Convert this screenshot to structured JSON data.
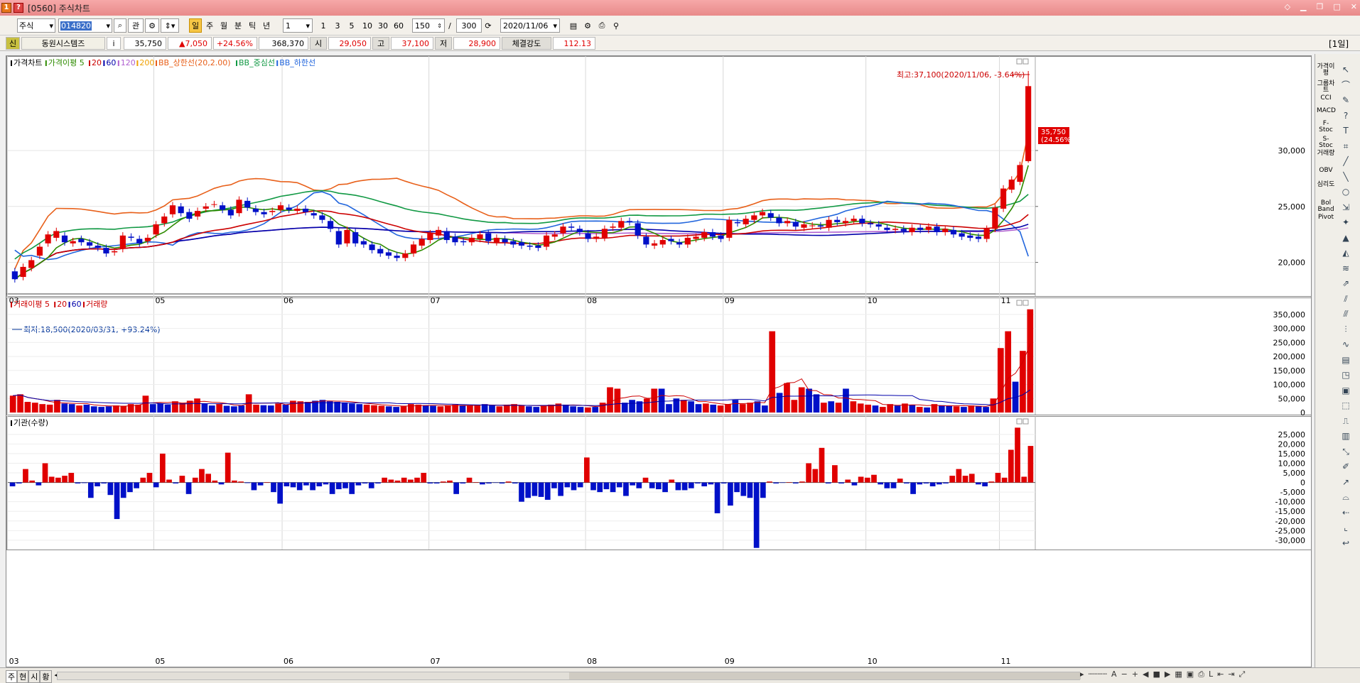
{
  "window": {
    "title": "[0560] 주식차트",
    "btn1": "1",
    "btn2": "?"
  },
  "toolbar": {
    "market": "주식",
    "code": "014820",
    "find": "관",
    "periods": [
      "일",
      "주",
      "월",
      "분",
      "틱",
      "년"
    ],
    "tick_value": "1",
    "minute_opts": [
      "1",
      "3",
      "5",
      "10",
      "30",
      "60"
    ],
    "count": "150",
    "total": "300",
    "date": "2020/11/06"
  },
  "info": {
    "flag": "신",
    "name": "동원시스템즈",
    "info_btn": "i",
    "price": "35,750",
    "change": "▲7,050",
    "rate": "+24.56%",
    "volume": "368,370",
    "open_label": "시",
    "open": "29,050",
    "high_label": "고",
    "high": "37,100",
    "low_label": "저",
    "low": "28,900",
    "strength_label": "체결강도",
    "strength": "112.13",
    "period_badge": "[1일]"
  },
  "legend": {
    "price": [
      {
        "t": "가격차트",
        "c": "#000000"
      },
      {
        "t": "가격이평 5",
        "c": "#2e8b00"
      },
      {
        "t": "20",
        "c": "#cc0000"
      },
      {
        "t": "60",
        "c": "#0000aa"
      },
      {
        "t": "120",
        "c": "#b060d0"
      },
      {
        "t": "200",
        "c": "#f0a000"
      },
      {
        "t": "BB_상한선(20,2.00)",
        "c": "#e8601a"
      },
      {
        "t": "BB_중심선",
        "c": "#119944"
      },
      {
        "t": "BB_하한선",
        "c": "#2266dd"
      }
    ],
    "volume": [
      {
        "t": "거래이평 5",
        "c": "#cc0000"
      },
      {
        "t": "20",
        "c": "#cc0000"
      },
      {
        "t": "60",
        "c": "#0000aa"
      },
      {
        "t": "거래량",
        "c": "#cc0000"
      }
    ],
    "inst": [
      {
        "t": "기관(수량)",
        "c": "#000000"
      }
    ]
  },
  "annotations": {
    "high": "최고:37,100(2020/11/06, -3.64%)",
    "low": "최저:18,500(2020/03/31, +93.24%)",
    "last_price": "35,750",
    "last_rate": "(24.56%)"
  },
  "x_labels": [
    "03",
    "05",
    "06",
    "07",
    "08",
    "09",
    "10",
    "11"
  ],
  "price_axis": [
    "30,000",
    "25,000",
    "20,000"
  ],
  "volume_axis": [
    "350,000",
    "300,000",
    "250,000",
    "200,000",
    "150,000",
    "100,000",
    "50,000",
    "0"
  ],
  "inst_axis": [
    "25,000",
    "20,000",
    "15,000",
    "10,000",
    "5,000",
    "0",
    "-5,000",
    "-10,000",
    "-15,000",
    "-20,000",
    "-25,000",
    "-30,000"
  ],
  "right_tools": [
    "가격이평",
    "그룹차트",
    "CCI",
    "MACD",
    "F-Stoc",
    "S-Stoc",
    "거래량",
    "OBV",
    "심리도",
    "Bol Band",
    "Pivot"
  ],
  "bottom": {
    "tabs": [
      "주",
      "현",
      "시",
      "황"
    ]
  },
  "chart_data": [
    {
      "type": "candlestick",
      "title": "가격차트",
      "ylim": [
        17500,
        37800
      ],
      "close": [
        18500,
        19600,
        20200,
        21400,
        22500,
        22800,
        21800,
        21900,
        21800,
        21500,
        21300,
        20800,
        21000,
        22400,
        22200,
        21700,
        22200,
        23400,
        24100,
        25100,
        24400,
        23900,
        24600,
        25000,
        25200,
        24700,
        24200,
        25600,
        24900,
        24500,
        24300,
        24600,
        25100,
        24700,
        24800,
        24500,
        24200,
        23800,
        23000,
        21600,
        22900,
        21700,
        21600,
        21100,
        20800,
        20600,
        20400,
        20800,
        21600,
        22100,
        22600,
        22900,
        22000,
        21800,
        21800,
        22200,
        22500,
        21900,
        22200,
        21800,
        21600,
        21500,
        21400,
        21300,
        22400,
        22500,
        23200,
        23100,
        22700,
        22100,
        22300,
        23000,
        23200,
        23700,
        23600,
        22400,
        21600,
        21700,
        22000,
        21900,
        21600,
        22200,
        22300,
        22700,
        22300,
        22100,
        23800,
        23500,
        23900,
        24200,
        24500,
        24000,
        23500,
        23700,
        23200,
        23400,
        23300,
        23200,
        23800,
        23600,
        23700,
        23900,
        23500,
        23400,
        23200,
        22900,
        23000,
        22800,
        23100,
        22900,
        23200,
        22700,
        23000,
        22500,
        22300,
        22200,
        22100,
        23000,
        24900,
        26600,
        27400,
        28700,
        35750
      ],
      "open": [
        19200,
        18700,
        19500,
        20600,
        21700,
        22200,
        22400,
        21700,
        22100,
        21800,
        21500,
        21300,
        20900,
        21200,
        22300,
        22100,
        21900,
        22500,
        23500,
        24300,
        25000,
        24500,
        24100,
        24800,
        25200,
        25100,
        24700,
        24400,
        25500,
        24800,
        24500,
        24500,
        24700,
        24900,
        24600,
        24800,
        24400,
        24200,
        23700,
        22800,
        21700,
        22700,
        21900,
        21600,
        21200,
        20900,
        20600,
        20400,
        20800,
        21500,
        22000,
        22400,
        22800,
        22300,
        21900,
        21800,
        22100,
        22600,
        21800,
        22100,
        21900,
        21800,
        21500,
        21500,
        21400,
        22300,
        22600,
        23200,
        23000,
        22600,
        22100,
        22200,
        23100,
        23100,
        23700,
        23500,
        22300,
        21500,
        21600,
        22100,
        21800,
        21600,
        22100,
        22200,
        22700,
        22400,
        22200,
        23600,
        23400,
        23800,
        24200,
        24400,
        24000,
        23500,
        23600,
        23100,
        23300,
        23300,
        23100,
        23800,
        23500,
        23700,
        23900,
        23500,
        23400,
        23100,
        22900,
        23000,
        22700,
        23100,
        22900,
        23200,
        22700,
        22900,
        22600,
        22400,
        22300,
        22100,
        23000,
        24800,
        26500,
        27200,
        29050
      ]
    },
    {
      "type": "bar",
      "title": "거래량",
      "ylim": [
        0,
        370000
      ],
      "values": [
        60000,
        65000,
        38000,
        35000,
        30000,
        28000,
        45000,
        32000,
        30000,
        25000,
        28000,
        22000,
        20000,
        22000,
        25000,
        24000,
        30000,
        28000,
        60000,
        30000,
        32000,
        28000,
        40000,
        35000,
        42000,
        50000,
        32000,
        25000,
        30000,
        24000,
        22000,
        25000,
        65000,
        28000,
        26000,
        25000,
        32000,
        28000,
        42000,
        40000,
        38000,
        42000,
        45000,
        40000,
        38000,
        36000,
        32000,
        30000,
        28000,
        26000,
        24000,
        22000,
        20000,
        22000,
        30000,
        28000,
        26000,
        24000,
        22000,
        25000,
        28000,
        26000,
        24000,
        28000,
        30000,
        25000,
        22000,
        28000,
        30000,
        24000,
        22000,
        20000,
        24000,
        28000,
        32000,
        28000,
        22000,
        20000,
        18000,
        20000,
        35000,
        90000,
        85000,
        35000,
        45000,
        40000,
        50000,
        85000,
        85000,
        30000,
        50000,
        45000,
        40000,
        30000,
        32000,
        28000,
        25000,
        30000,
        45000,
        30000,
        35000,
        40000,
        25000,
        290000,
        70000,
        105000,
        45000,
        90000,
        85000,
        65000,
        35000,
        40000,
        35000,
        85000,
        40000,
        32000,
        28000,
        25000,
        20000,
        30000,
        25000,
        32000,
        28000,
        20000,
        18000,
        30000,
        26000,
        25000,
        22000,
        20000,
        25000,
        22000,
        20000,
        50000,
        230000,
        290000,
        110000,
        220000,
        368370
      ],
      "colors": [
        "r",
        "r",
        "r",
        "r",
        "r",
        "r",
        "r",
        "b",
        "b",
        "r",
        "b",
        "b",
        "b",
        "b",
        "r",
        "r",
        "r",
        "r",
        "r",
        "b",
        "b",
        "b",
        "r",
        "r",
        "r",
        "r",
        "b",
        "b",
        "r",
        "b",
        "b",
        "b",
        "r",
        "r",
        "b",
        "b",
        "r",
        "b",
        "r",
        "r",
        "b",
        "b",
        "b",
        "b",
        "b",
        "b",
        "b",
        "b",
        "r",
        "r",
        "r",
        "b",
        "b",
        "r",
        "r",
        "r",
        "b",
        "b",
        "r",
        "r",
        "r",
        "b",
        "r",
        "r",
        "b",
        "b",
        "r",
        "r",
        "r",
        "r",
        "b",
        "b",
        "r",
        "r",
        "r",
        "b",
        "b",
        "b",
        "r",
        "b",
        "r",
        "r",
        "r",
        "b",
        "b",
        "b",
        "r",
        "r",
        "b",
        "b",
        "b",
        "r",
        "b",
        "b",
        "r",
        "b",
        "r",
        "r",
        "b",
        "r",
        "r",
        "b",
        "b",
        "r",
        "b",
        "r",
        "r",
        "r",
        "b",
        "b",
        "r",
        "b",
        "r",
        "b",
        "r",
        "r",
        "r",
        "b",
        "r",
        "r",
        "b",
        "r",
        "b",
        "r",
        "b",
        "r",
        "b",
        "b",
        "r",
        "b",
        "r",
        "b",
        "b",
        "r",
        "r",
        "r",
        "b",
        "r",
        "r"
      ]
    },
    {
      "type": "bar",
      "title": "기관(수량)",
      "ylim": [
        -33000,
        29000
      ],
      "values": [
        -2000,
        -500,
        7000,
        1000,
        -1500,
        10000,
        3000,
        2500,
        3500,
        5000,
        -500,
        -300,
        -8000,
        -2000,
        -500,
        -6500,
        -19000,
        -8000,
        -5000,
        -3000,
        2500,
        5000,
        -2500,
        15000,
        1500,
        -500,
        3500,
        -6000,
        2500,
        7000,
        4500,
        1000,
        -1000,
        15500,
        1000,
        500,
        -300,
        -4000,
        -1500,
        200,
        -5000,
        -11000,
        -2000,
        -2500,
        -4000,
        -1500,
        -4000,
        -2000,
        -1000,
        -6000,
        -3500,
        -3000,
        -6000,
        -1500,
        -500,
        -3000,
        -500,
        2500,
        1500,
        1000,
        2500,
        1500,
        2500,
        5000,
        -500,
        -500,
        500,
        1000,
        -6000,
        -500,
        2500,
        200,
        -1000,
        -500,
        -200,
        -500,
        500,
        -500,
        -10000,
        -8000,
        -7000,
        -7500,
        -9000,
        -3000,
        -7000,
        -2500,
        -4000,
        -2500,
        13000,
        -4000,
        -5000,
        -3500,
        -5000,
        -2500,
        -7000,
        -1500,
        -3000,
        2500,
        -3000,
        -3500,
        -5000,
        1500,
        -4000,
        -4000,
        -3000,
        -500,
        -2000,
        -1000,
        -16000,
        -500,
        -12000,
        -5000,
        -7000,
        -8000,
        -34000,
        -8000,
        500,
        -500,
        -200,
        200,
        -500,
        500,
        10000,
        7000,
        18000,
        -500,
        9000,
        -500,
        1500,
        -1500,
        3000,
        2500,
        4000,
        -1000,
        -3000,
        -3000,
        2000,
        -500,
        -6000,
        -1000,
        -500,
        -2000,
        -1000,
        -500,
        3500,
        7000,
        3500,
        4500,
        -1000,
        -2000,
        500,
        5000,
        2500,
        17000,
        28500,
        3000,
        19000
      ]
    }
  ]
}
